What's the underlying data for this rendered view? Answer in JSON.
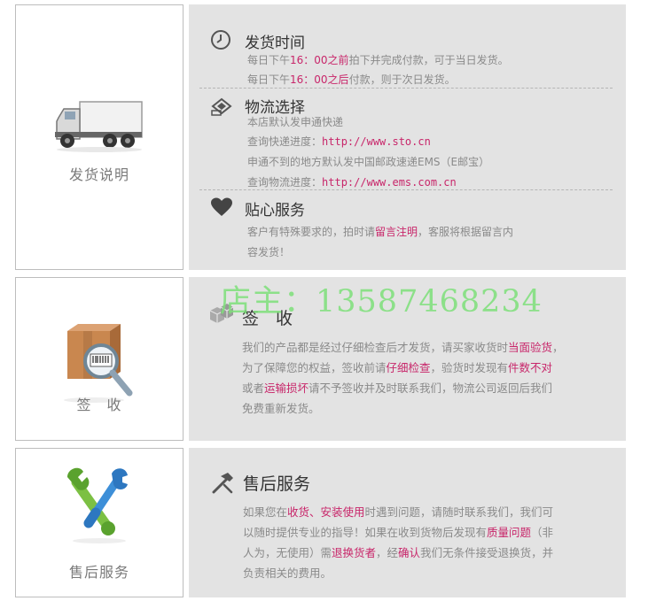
{
  "shipping": {
    "left_label": "发货说明",
    "time": {
      "title": "发货时间",
      "line1": {
        "a": "每日下午",
        "b": "16：00之前",
        "c": "拍下并完成付款，可于当日发货。"
      },
      "line2": {
        "a": "每日下午",
        "b": "16：00之后",
        "c": "付款，则于次日发货。"
      }
    },
    "logistics": {
      "title": "物流选择",
      "line1": "本店默认发申通快递",
      "line2_prefix": "查询快递进度：",
      "line2_url": "http://www.sto.cn",
      "line3": "申通不到的地方默认发中国邮政速递EMS（E邮宝）",
      "line4_prefix": "查询物流进度：",
      "line4_url": "http://www.ems.com.cn"
    },
    "service": {
      "title": "贴心服务",
      "line1": {
        "a": "客户有特殊要求的，拍时请",
        "b": "留言注明",
        "c": "，客服将根据留言内"
      },
      "line2": "容发货！"
    }
  },
  "sign": {
    "left_label": "签　收",
    "title": "签　收",
    "line1": {
      "a": "我们的产品都是经过仔细检查后才发货，请买家收货时",
      "b": "当面验货",
      "c": "，"
    },
    "line2": {
      "a": "为了保障您的权益，签收前请",
      "b": "仔细检查",
      "c": "，验货时发现有",
      "d": "件数不对"
    },
    "line3": {
      "a": "或者",
      "b": "运输损坏",
      "c": "请不予签收并及时联系我们，物流公司返回后我们"
    },
    "line4": "免费重新发货。"
  },
  "aftersale": {
    "left_label": "售后服务",
    "title": "售后服务",
    "line1": {
      "a": "如果您在",
      "b": "收货、安装使用",
      "c": "时遇到问题，请随时联系我们，我们可"
    },
    "line2": {
      "a": "以随时提供专业的指导！如果在收到货物后发现有",
      "b": "质量问题",
      "c": "（非"
    },
    "line3": {
      "a": "人为，无使用）需",
      "b": "退换货者",
      "c": "，经",
      "d": "确认",
      "e": "我们无条件接受退换货，并"
    },
    "line4": "负责相关的费用。"
  },
  "watermark": "店主：13587468234",
  "colors": {
    "accent": "#c8266a",
    "panel_bg": "#e3e3e3",
    "watermark": "#7ee07a"
  }
}
